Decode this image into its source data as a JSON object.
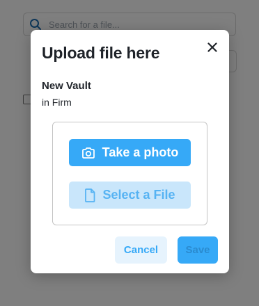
{
  "background": {
    "search_placeholder": "Search for a file..."
  },
  "modal": {
    "title": "Upload file here",
    "vault_name": "New Vault",
    "vault_location": "in Firm",
    "take_photo_label": "Take a photo",
    "select_file_label": "Select a File",
    "cancel_label": "Cancel",
    "save_label": "Save"
  },
  "icons": {
    "close": "close-icon",
    "camera": "camera-icon",
    "file": "file-icon",
    "search": "search-icon"
  },
  "colors": {
    "primary": "#36a9f7",
    "primary_light": "#c9e6fb",
    "cancel_bg": "#e6f3fd",
    "text_dark": "#1f2329"
  }
}
